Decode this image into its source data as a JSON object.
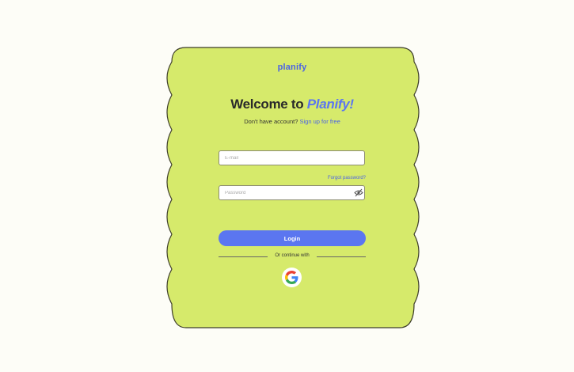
{
  "brand": {
    "name": "planify"
  },
  "heading": {
    "prefix": "Welcome to",
    "accent": "Planify!"
  },
  "signup": {
    "prompt": "Don't have account?",
    "link": "Sign up for free"
  },
  "form": {
    "email_placeholder": "E-mail",
    "password_placeholder": "Password",
    "forgot_password": "Forgot password?",
    "login_button": "Login"
  },
  "social": {
    "divider_text": "Or continue with",
    "provider_icon": "google-icon"
  },
  "colors": {
    "card": "#d6ea6b",
    "accent": "#5b76f0",
    "background": "#fdfdf7"
  }
}
